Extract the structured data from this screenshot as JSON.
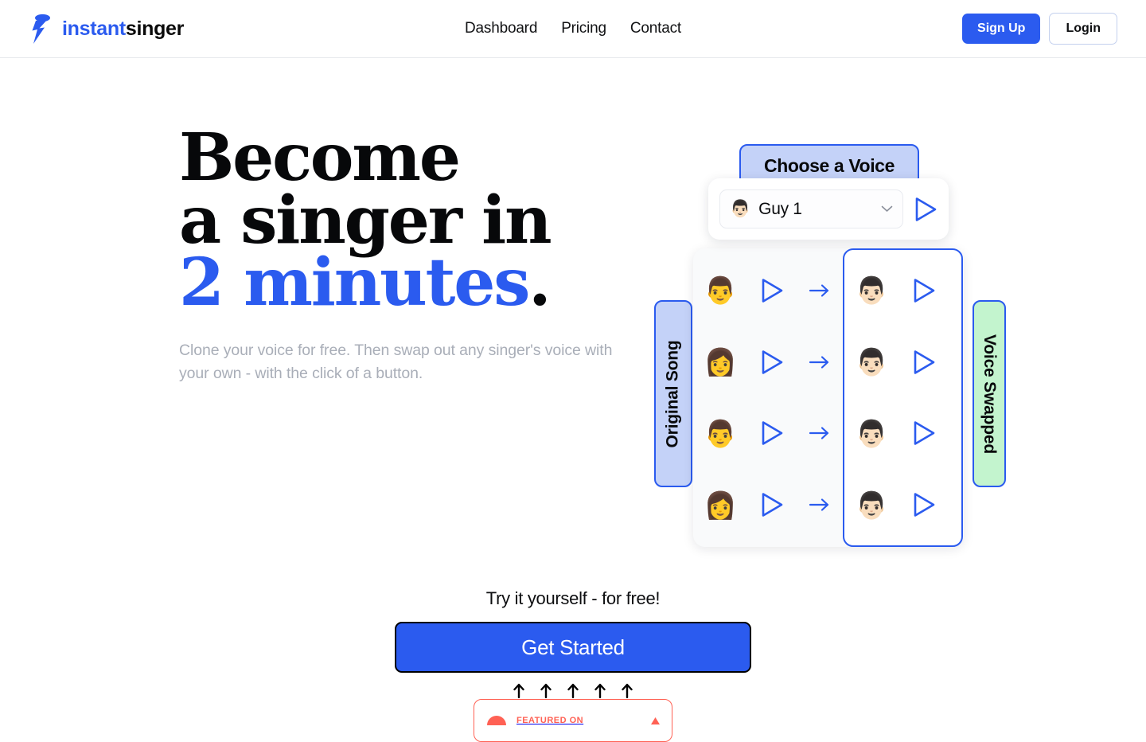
{
  "brand": {
    "icon": "lightning-microphone-icon",
    "name_first": "instant",
    "name_second": "singer"
  },
  "nav": {
    "items": [
      {
        "label": "Dashboard"
      },
      {
        "label": "Pricing"
      },
      {
        "label": "Contact"
      }
    ]
  },
  "auth": {
    "signup_label": "Sign Up",
    "login_label": "Login"
  },
  "hero": {
    "headline_line1": "Become",
    "headline_line2": "a singer in",
    "headline_accent": "2 minutes",
    "headline_period": ".",
    "subtitle": "Clone your voice for free. Then swap out any singer's voice with your own - with the click of a button."
  },
  "illustration": {
    "badge_choose": "Choose a Voice",
    "badge_original": "Original Song",
    "badge_swapped": "Voice Swapped",
    "voice_selector": {
      "avatar": "👨🏻",
      "value": "Guy 1",
      "chevron": "chevron-down-icon",
      "play": "play-icon"
    },
    "rows": [
      {
        "source_avatar": "👨",
        "target_avatar": "👨🏻"
      },
      {
        "source_avatar": "👩",
        "target_avatar": "👨🏻"
      },
      {
        "source_avatar": "👨",
        "target_avatar": "👨🏻"
      },
      {
        "source_avatar": "👩",
        "target_avatar": "👨🏻"
      }
    ]
  },
  "cta": {
    "label": "Try it yourself - for free!",
    "button_label": "Get Started",
    "arrow_count": 5
  },
  "product_hunt": {
    "text": "FEATURED ON",
    "logo": "product-hunt-logo-icon",
    "upvote": "upvote-triangle-icon"
  },
  "colors": {
    "brand_blue": "#2b5bef",
    "badge_blue_bg": "#c4d2f8",
    "badge_green_bg": "#c3f4ce",
    "subtitle_grey": "#a9aeb8",
    "product_hunt_orange": "#ff6154"
  }
}
